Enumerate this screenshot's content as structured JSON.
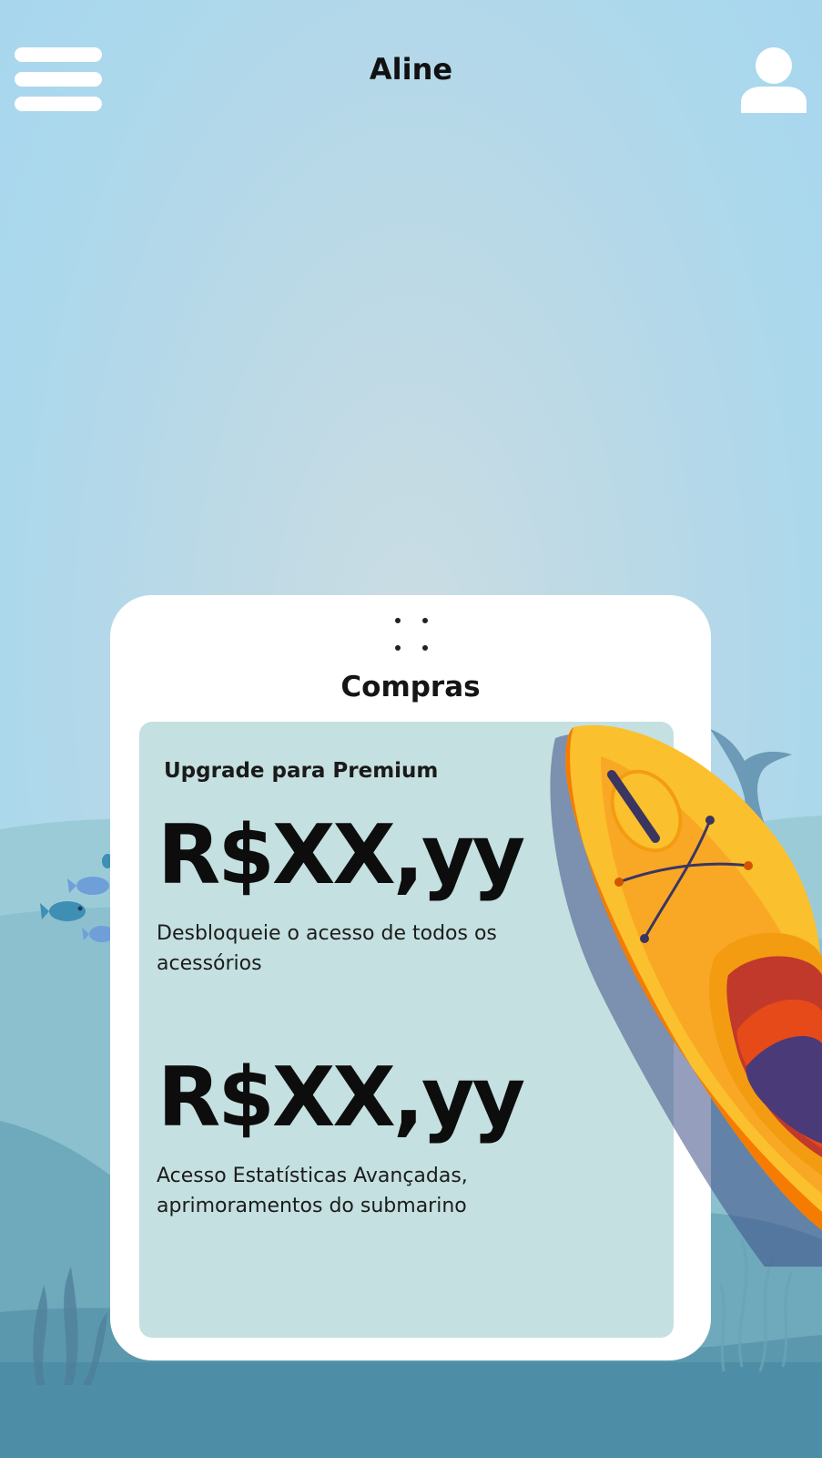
{
  "header": {
    "title": "Aline",
    "menu_icon": "hamburger-menu-icon",
    "profile_icon": "user-profile-icon"
  },
  "purchase_card": {
    "title": "Compras",
    "drag_handle_icon": "drag-handle-dots-icon",
    "upgrade_title": "Upgrade para Premium",
    "offers": [
      {
        "price": "R$XX,yy",
        "description": "Desbloqueie o acesso de todos os acessórios"
      },
      {
        "price": "R$XX,yy",
        "description": "Acesso Estatísticas Avançadas, aprimoramentos do submarino"
      }
    ]
  },
  "colors": {
    "sky_top": "#a6d6ee",
    "sky_center": "#cbdde3",
    "sea_light": "#9ccbd8",
    "sea_mid": "#79b3c4",
    "sea_deep": "#4d8ea6",
    "card_background": "#ffffff",
    "panel_background": "#c5e0e0",
    "kayak_yellow": "#fbc02d",
    "kayak_orange": "#f57c00",
    "kayak_purple": "#4a3a78"
  }
}
